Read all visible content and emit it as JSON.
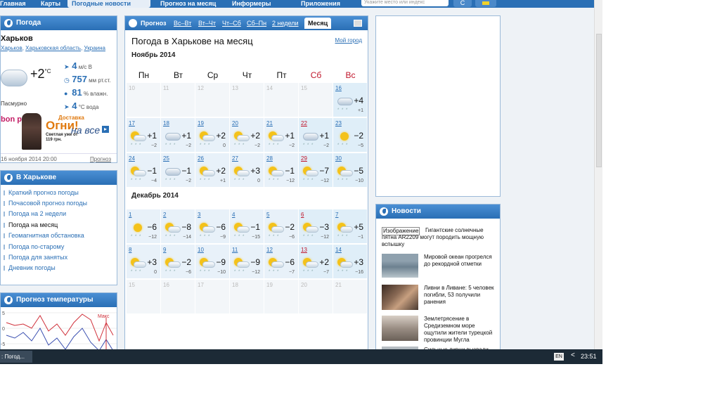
{
  "nav": {
    "tabs": [
      "Главная",
      "Карты",
      "Погодные новости",
      "Прогноз на месяц",
      "Информеры",
      "Приложения"
    ],
    "search_placeholder": "Укажите место или индекс",
    "search_button": "С"
  },
  "weather": {
    "header": "Погода",
    "city": "Харьков",
    "crumbs": [
      "Харьков",
      "Харьковская область",
      "Украина"
    ],
    "temp": "+2",
    "temp_unit": "°С",
    "condition": "Пасмурно",
    "wind_value": "4",
    "wind_unit": "м/с",
    "wind_dir": "В",
    "pressure_value": "757",
    "pressure_unit": "мм рт.ст.",
    "humidity_value": "81",
    "humidity_unit": "% влажн.",
    "water_value": "4",
    "water_unit": "°С вода",
    "ad": {
      "brand": "bon prix",
      "line1": "Доставка",
      "line2": "Огни!",
      "line3": "на все",
      "line4": "Светлая уже от 119 грн."
    },
    "updated": "16 ноября 2014 20:00",
    "forecast_link": "Прогноз"
  },
  "links": {
    "header": "В Харькове",
    "items": [
      "Краткий прогноз погоды",
      "Почасовой прогноз погоды",
      "Погода на 2 недели",
      "Погода на месяц",
      "Геомагнитная обстановка",
      "Погода по-старому",
      "Погода для занятых",
      "Дневник погоды"
    ]
  },
  "tempgraph": {
    "header": "Прогноз температуры",
    "max_label": "Макс",
    "y_ticks": [
      "5",
      "0",
      "-5"
    ]
  },
  "center": {
    "tabs": [
      "Прогноз",
      "Вс–Вт",
      "Вт–Чт",
      "Чт–Сб",
      "Сб–Пн",
      "2 недели",
      "Месяц"
    ],
    "title": "Погода в Харькове на месяц",
    "my_city": "Мой город",
    "weekdays": [
      "Пн",
      "Вт",
      "Ср",
      "Чт",
      "Пт",
      "Сб",
      "Вс"
    ],
    "months": [
      {
        "name": "Ноябрь 2014",
        "weeks": [
          [
            {
              "d": "10"
            },
            {
              "d": "11"
            },
            {
              "d": "12"
            },
            {
              "d": "13"
            },
            {
              "d": "14"
            },
            {
              "d": "15"
            },
            {
              "d": "16",
              "t": "+4",
              "n": "+1",
              "icon": "cloud"
            }
          ],
          [
            {
              "d": "17",
              "t": "+1",
              "n": "−2",
              "icon": "sun-cloud"
            },
            {
              "d": "18",
              "t": "+1",
              "n": "−2",
              "icon": "cloud"
            },
            {
              "d": "19",
              "t": "+2",
              "n": "0",
              "icon": "sun-cloud"
            },
            {
              "d": "20",
              "t": "+2",
              "n": "−2",
              "icon": "sun-cloud"
            },
            {
              "d": "21",
              "t": "+1",
              "n": "−2",
              "icon": "sun-cloud"
            },
            {
              "d": "22",
              "t": "+1",
              "n": "−2",
              "icon": "cloud"
            },
            {
              "d": "23",
              "t": "−2",
              "n": "−5",
              "icon": "sun"
            }
          ],
          [
            {
              "d": "24",
              "t": "−1",
              "n": "−4",
              "icon": "sun-cloud"
            },
            {
              "d": "25",
              "t": "−1",
              "n": "−2",
              "icon": "cloud"
            },
            {
              "d": "26",
              "t": "+2",
              "n": "+1",
              "icon": "sun-cloud"
            },
            {
              "d": "27",
              "t": "+3",
              "n": "0",
              "icon": "sun-cloud"
            },
            {
              "d": "28",
              "t": "−1",
              "n": "−12",
              "icon": "sun-cloud"
            },
            {
              "d": "29",
              "t": "−7",
              "n": "−12",
              "icon": "sun-cloud"
            },
            {
              "d": "30",
              "t": "−5",
              "n": "−10",
              "icon": "sun-cloud"
            }
          ]
        ]
      },
      {
        "name": "Декабрь 2014",
        "weeks": [
          [
            {
              "d": "1",
              "t": "−6",
              "n": "−12",
              "icon": "sun"
            },
            {
              "d": "2",
              "t": "−8",
              "n": "−14",
              "icon": "sun-cloud"
            },
            {
              "d": "3",
              "t": "−6",
              "n": "−9",
              "icon": "sun-cloud"
            },
            {
              "d": "4",
              "t": "−1",
              "n": "−15",
              "icon": "sun-cloud"
            },
            {
              "d": "5",
              "t": "−2",
              "n": "−6",
              "icon": "sun-cloud"
            },
            {
              "d": "6",
              "t": "−3",
              "n": "−12",
              "icon": "sun-cloud"
            },
            {
              "d": "7",
              "t": "+5",
              "n": "−1",
              "icon": "sun-cloud"
            }
          ],
          [
            {
              "d": "8",
              "t": "+3",
              "n": "0",
              "icon": "sun-cloud"
            },
            {
              "d": "9",
              "t": "−2",
              "n": "−6",
              "icon": "sun-cloud"
            },
            {
              "d": "10",
              "t": "−9",
              "n": "−10",
              "icon": "sun-cloud"
            },
            {
              "d": "11",
              "t": "−9",
              "n": "−12",
              "icon": "sun-cloud"
            },
            {
              "d": "12",
              "t": "−6",
              "n": "−7",
              "icon": "sun-cloud"
            },
            {
              "d": "13",
              "t": "+2",
              "n": "−7",
              "icon": "sun-cloud"
            },
            {
              "d": "14",
              "t": "+3",
              "n": "−16",
              "icon": "sun-cloud"
            }
          ],
          [
            {
              "d": "15"
            },
            {
              "d": "16"
            },
            {
              "d": "17"
            },
            {
              "d": "18"
            },
            {
              "d": "19"
            },
            {
              "d": "20"
            },
            {
              "d": "21"
            }
          ]
        ]
      }
    ]
  },
  "news": {
    "header": "Новости",
    "items": [
      {
        "badge": "Изображение",
        "text": "Гигантские солнечные пятна AR2209 могут породить мощную вспышку"
      },
      {
        "text": "Мировой океан прогрелся до рекордной отметки"
      },
      {
        "text": "Ливни в Ливане: 5 человек погибли, 53 получили ранения"
      },
      {
        "text": "Землетрясение в Средиземном море ощутили жители турецкой провинции Мугла"
      },
      {
        "text": "Сильные ливни вызвали"
      }
    ]
  },
  "taskbar": {
    "task": ": Погод...",
    "lang": "EN",
    "tray": "<",
    "clock": "23:51"
  }
}
